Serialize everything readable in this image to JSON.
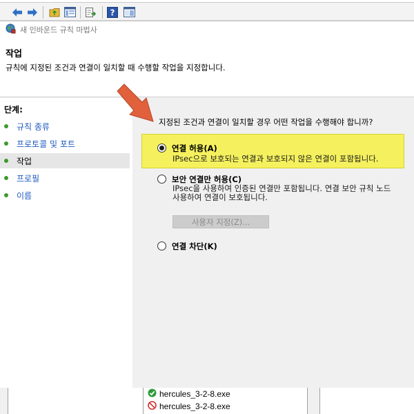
{
  "wizard": {
    "title": "새 인바운드 규칙 마법사",
    "page_title": "작업",
    "page_description": "규칙에 지정된 조건과 연결이 일치할 때 수행할 작업을 지정합니다."
  },
  "steps": {
    "title": "단계:",
    "items": [
      {
        "label": "규칙 종류"
      },
      {
        "label": "프로토콜 및 포트"
      },
      {
        "label": "작업"
      },
      {
        "label": "프로필"
      },
      {
        "label": "이름"
      }
    ]
  },
  "content": {
    "question": "지정된 조건과 연결이 일치할 경우 어떤 작업을 수행해야 합니까?",
    "options": [
      {
        "label": "연결 허용(A)",
        "description": "IPsec으로 보호되는 연결과 보호되지 않은 연결이 포함됩니다.",
        "selected": true
      },
      {
        "label": "보안 연결만 허용(C)",
        "description_line1": "IPsec을 사용하여 인증된 연결만 포함됩니다. 연결 보안 규칙 노드",
        "description_line2": "사용하여 연결이 보호됩니다.",
        "selected": false
      },
      {
        "label": "연결 차단(K)",
        "selected": false
      }
    ],
    "customize_label": "사용자 지정(Z)..."
  },
  "background": {
    "files": [
      {
        "name": "hercules_3-2-8.exe",
        "status": "allowed"
      },
      {
        "name": "hercules_3-2-8.exe",
        "status": "blocked"
      }
    ]
  },
  "colors": {
    "highlight": "#f5f15e",
    "arrow": "#e0613c",
    "link": "#1e5bbf",
    "step_dot": "#3c9a2c"
  }
}
